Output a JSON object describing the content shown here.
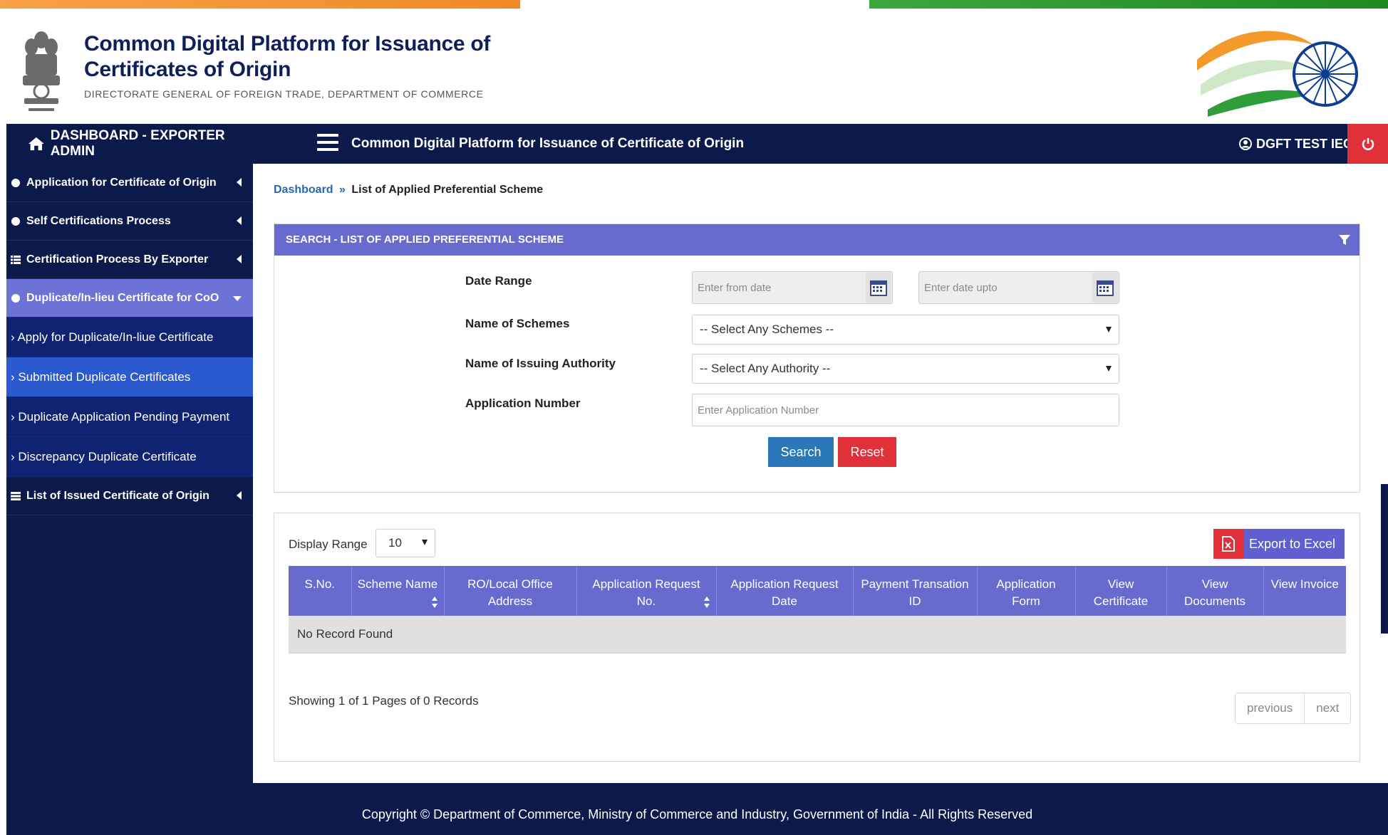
{
  "header": {
    "title_line1": "Common Digital Platform for Issuance of",
    "title_line2": "Certificates of Origin",
    "subtitle": "DIRECTORATE GENERAL OF FOREIGN TRADE, DEPARTMENT OF COMMERCE",
    "emblem_icon": "state-emblem-icon",
    "flag_icon": "indian-flag-chakra-icon"
  },
  "navbar": {
    "brand": "DASHBOARD - EXPORTER ADMIN",
    "title": "Common Digital Platform for Issuance of Certificate of Origin",
    "user": "DGFT TEST IEC"
  },
  "sidebar": {
    "items": [
      {
        "label": "Application for Certificate of Origin"
      },
      {
        "label": "Self Certifications Process"
      },
      {
        "label": "Certification Process By Exporter"
      },
      {
        "label": "Duplicate/In-lieu Certificate for CoO"
      }
    ],
    "sub_items": [
      {
        "label": "› Apply for Duplicate/In-liue Certificate"
      },
      {
        "label": "› Submitted Duplicate Certificates"
      },
      {
        "label": "› Duplicate Application Pending Payment"
      },
      {
        "label": "› Discrepancy Duplicate Certificate"
      }
    ],
    "last_item": {
      "label": "List of Issued Certificate of Origin"
    }
  },
  "breadcrumb": {
    "home": "Dashboard",
    "separator": "»",
    "current": "List of Applied Preferential Scheme"
  },
  "search_panel": {
    "title": "SEARCH - LIST OF APPLIED PREFERENTIAL SCHEME",
    "date_range_label": "Date Range",
    "from_placeholder": "Enter from date",
    "upto_placeholder": "Enter date upto",
    "schemes_label": "Name of Schemes",
    "schemes_value": "-- Select Any Schemes --",
    "authority_label": "Name of Issuing Authority",
    "authority_value": "-- Select Any Authority --",
    "app_number_label": "Application Number",
    "app_number_placeholder": "Enter Application Number",
    "search_button": "Search",
    "reset_button": "Reset"
  },
  "results": {
    "display_range_label": "Display Range",
    "display_range_value": "10",
    "export_button": "Export to Excel",
    "columns": [
      {
        "line1": "S.No.",
        "line2": ""
      },
      {
        "line1": "Scheme Name",
        "line2": ""
      },
      {
        "line1": "RO/Local Office",
        "line2": "Address"
      },
      {
        "line1": "Application Request",
        "line2": "No."
      },
      {
        "line1": "Application Request",
        "line2": "Date"
      },
      {
        "line1": "Payment Transation",
        "line2": "ID"
      },
      {
        "line1": "Application",
        "line2": "Form"
      },
      {
        "line1": "View",
        "line2": "Certificate"
      },
      {
        "line1": "View",
        "line2": "Documents"
      },
      {
        "line1": "View Invoice",
        "line2": ""
      }
    ],
    "empty_message": "No Record Found",
    "showing_text": "Showing 1 of 1 Pages of 0 Records",
    "previous_label": "previous",
    "next_label": "next"
  },
  "footer": {
    "text": "Copyright © Department of Commerce, Ministry of Commerce and Industry, Government of India - All Rights Reserved"
  },
  "colors": {
    "navy": "#0b1a4a",
    "panel_header": "#666bcd",
    "active_sidebar": "#2b5ad0",
    "search_button": "#2b78b8",
    "reset_button": "#e0313b"
  }
}
